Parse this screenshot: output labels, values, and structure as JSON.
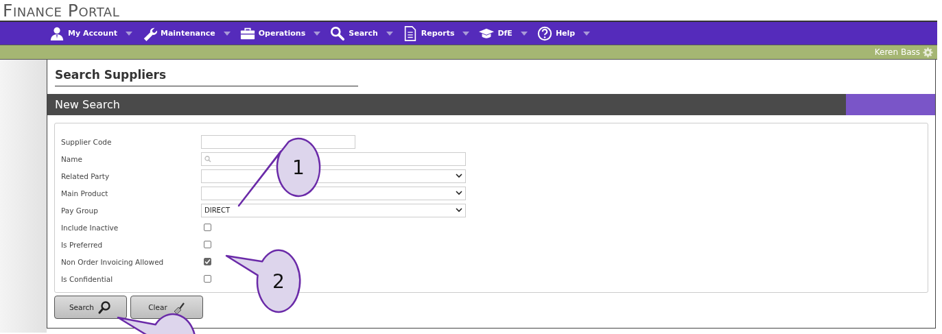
{
  "app_title": "Finance Portal",
  "nav": [
    {
      "label": "My Account"
    },
    {
      "label": "Maintenance"
    },
    {
      "label": "Operations"
    },
    {
      "label": "Search"
    },
    {
      "label": "Reports"
    },
    {
      "label": "DfE"
    },
    {
      "label": "Help"
    }
  ],
  "user": "Keren Bass",
  "page_title": "Search Suppliers",
  "section_title": "New Search",
  "fields": [
    {
      "label": "Supplier Code",
      "kind": "text"
    },
    {
      "label": "Name",
      "kind": "search"
    },
    {
      "label": "Related Party",
      "kind": "select"
    },
    {
      "label": "Main Product",
      "kind": "select"
    },
    {
      "label": "Pay Group",
      "kind": "select",
      "value": "DIRECT"
    },
    {
      "label": "Include Inactive",
      "kind": "checkbox",
      "checked": false
    },
    {
      "label": "Is Preferred",
      "kind": "checkbox",
      "checked": false
    },
    {
      "label": "Non Order Invoicing Allowed",
      "kind": "checkbox",
      "checked": true
    },
    {
      "label": "Is Confidential",
      "kind": "checkbox",
      "checked": false
    }
  ],
  "buttons": [
    {
      "label": "Search"
    },
    {
      "label": "Clear"
    }
  ],
  "callouts": [
    {
      "kind": "callout",
      "text": "1"
    },
    {
      "kind": "callout",
      "text": "2"
    },
    {
      "kind": "callout"
    }
  ]
}
